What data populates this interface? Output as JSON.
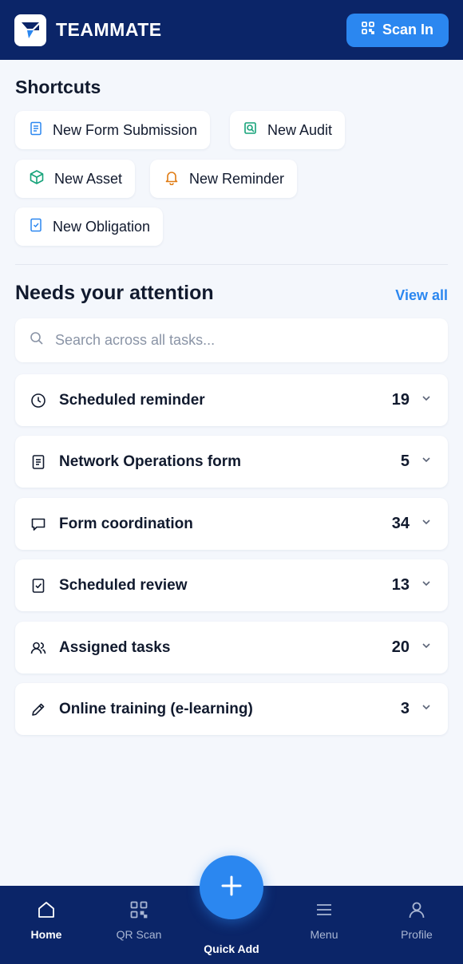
{
  "header": {
    "brand": "TEAMMATE",
    "scan_button": "Scan In"
  },
  "shortcuts": {
    "title": "Shortcuts",
    "items": [
      {
        "label": "New Form Submission",
        "icon": "form-icon",
        "color": "#2b87f0"
      },
      {
        "label": "New Audit",
        "icon": "audit-icon",
        "color": "#17a37a"
      },
      {
        "label": "New Asset",
        "icon": "cube-icon",
        "color": "#17a37a"
      },
      {
        "label": "New Reminder",
        "icon": "bell-icon",
        "color": "#e07b12"
      },
      {
        "label": "New Obligation",
        "icon": "clipboard-check-icon",
        "color": "#2b87f0"
      }
    ]
  },
  "attention": {
    "title": "Needs your attention",
    "view_all": "View all",
    "search_placeholder": "Search across all tasks...",
    "tasks": [
      {
        "label": "Scheduled reminder",
        "count": "19",
        "icon": "clock-icon"
      },
      {
        "label": "Network Operations form",
        "count": "5",
        "icon": "document-icon"
      },
      {
        "label": "Form coordination",
        "count": "34",
        "icon": "chat-icon"
      },
      {
        "label": "Scheduled review",
        "count": "13",
        "icon": "clipboard-check-icon"
      },
      {
        "label": "Assigned tasks",
        "count": "20",
        "icon": "users-icon"
      },
      {
        "label": "Online training (e-learning)",
        "count": "3",
        "icon": "pencil-icon"
      }
    ]
  },
  "nav": {
    "home": "Home",
    "qr_scan": "QR Scan",
    "quick_add": "Quick Add",
    "menu": "Menu",
    "profile": "Profile"
  },
  "colors": {
    "header_bg": "#0b2568",
    "accent": "#2b87f0",
    "page_bg": "#f4f7fc"
  }
}
